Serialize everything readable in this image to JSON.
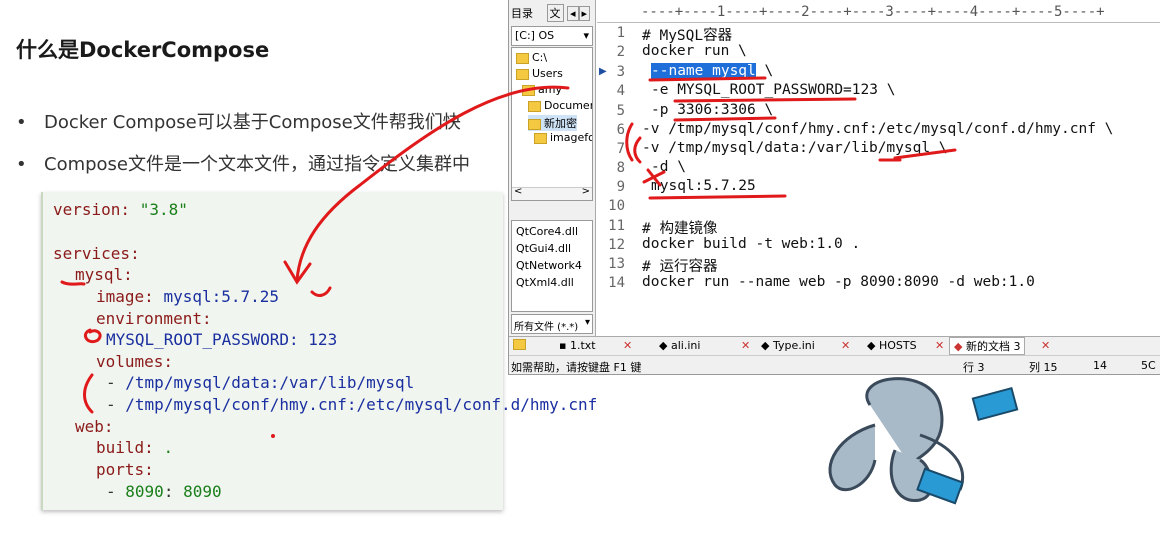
{
  "slide": {
    "title": "什么是DockerCompose",
    "bullets": [
      "Docker Compose可以基于Compose文件帮我们快",
      "Compose文件是一个文本文件，通过指令定义集群中"
    ],
    "bullet_symbol": "•"
  },
  "compose_code": {
    "l1a": "version:",
    "l1b": "\"3.8\"",
    "l2": "services:",
    "l3": "mysql:",
    "l4a": "image:",
    "l4b": "mysql:5.7.25",
    "l5": "environment:",
    "l6a": "MYSQL_ROOT_PASSWORD:",
    "l6b": "123",
    "l7": "volumes:",
    "l8a": "-",
    "l8b": "/tmp/mysql/data:/var/lib/mysql",
    "l9a": "-",
    "l9b": "/tmp/mysql/conf/hmy.cnf:/etc/mysql/conf.d/hmy.cnf",
    "l10": "web:",
    "l11a": "build:",
    "l11b": ".",
    "l12": "ports:",
    "l13a": "-",
    "l13b": "8090",
    "l13c": ":",
    "l13d": "8090"
  },
  "editor": {
    "panel_tab": "目录",
    "panel_tab2": "文",
    "drive": "[C:] OS",
    "tree": [
      "C:\\",
      "Users",
      "amy",
      "Document",
      "新加密",
      "imagefor"
    ],
    "files": [
      "QtCore4.dll",
      "QtGui4.dll",
      "QtNetwork4",
      "QtXml4.dll"
    ],
    "filter": "所有文件 (*.*)",
    "ruler": "----+----1----+----2----+----3----+----4----+----5----+",
    "line_numbers": [
      "1",
      "2",
      "3",
      "4",
      "5",
      "6",
      "7",
      "8",
      "9",
      "10",
      "11",
      "12",
      "13",
      "14"
    ],
    "lines": [
      "# MySQL容器",
      "docker run \\",
      "--name mysql",
      " \\",
      "-e MYSQL_ROOT_PASSWORD=123 \\",
      "-p 3306:3306 \\",
      "-v /tmp/mysql/conf/hmy.cnf:/etc/mysql/conf.d/hmy.cnf \\",
      "-v /tmp/mysql/data:/var/lib/mysql \\",
      "-d \\",
      "mysql:5.7.25",
      "",
      "# 构建镜像",
      "docker build -t web:1.0 .",
      "# 运行容器",
      "docker run --name web -p 8090:8090 -d web:1.0"
    ],
    "tabs": [
      "1.txt",
      "ali.ini",
      "Type.ini",
      "HOSTS",
      "新的文档 3"
    ],
    "status": {
      "help": "如需帮助，请按键盘 F1 键",
      "row": "行 3",
      "col": "列 15",
      "num": "14",
      "enc": "5C"
    }
  },
  "colors": {
    "selection": "#1e6fd9",
    "annotation_red": "#e0191b",
    "code_bg": "#f1f5ef"
  }
}
